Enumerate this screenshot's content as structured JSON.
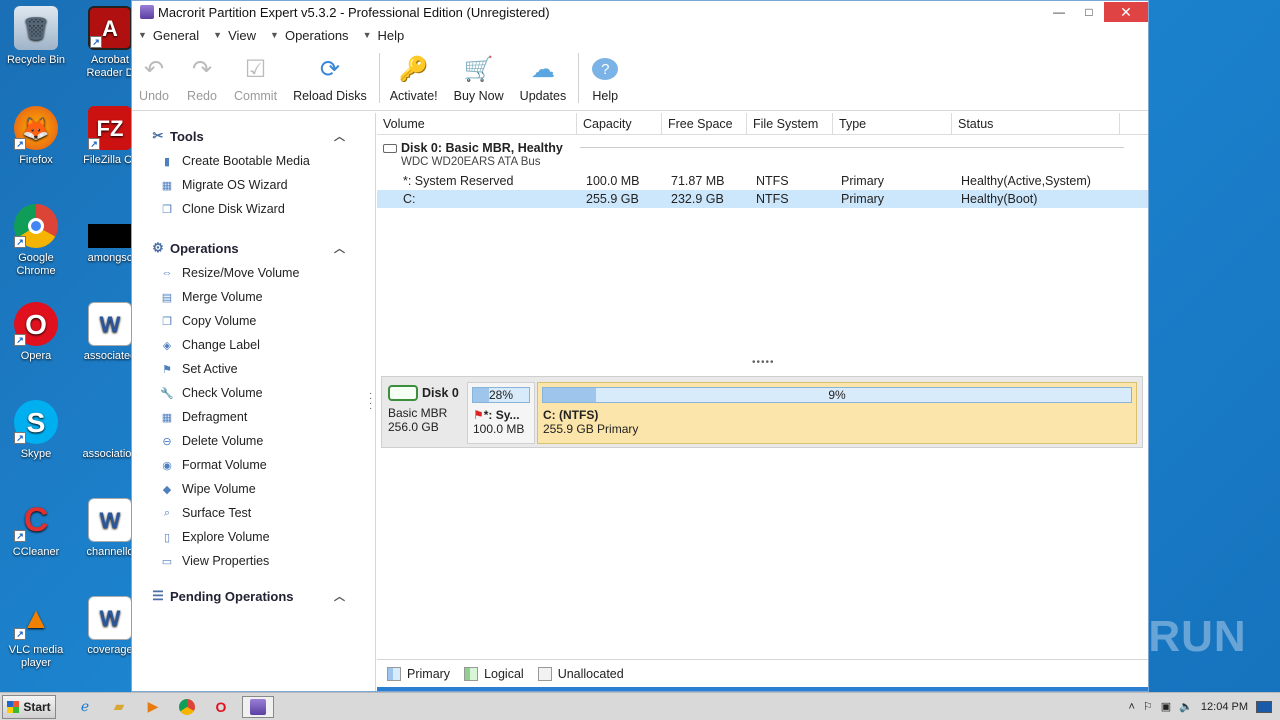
{
  "desktop": {
    "icons": [
      {
        "label": "Recycle Bin"
      },
      {
        "label": "Acrobat Reader D"
      },
      {
        "label": "Firefox"
      },
      {
        "label": "FileZilla Cli"
      },
      {
        "label": "Google Chrome"
      },
      {
        "label": "amongsc"
      },
      {
        "label": "Opera"
      },
      {
        "label": "associated"
      },
      {
        "label": "Skype"
      },
      {
        "label": "association"
      },
      {
        "label": "CCleaner"
      },
      {
        "label": "channello"
      },
      {
        "label": "VLC media player"
      },
      {
        "label": "coverage"
      }
    ],
    "watermark": "ANY RUN"
  },
  "window": {
    "title": "Macrorit Partition Expert v5.3.2 - Professional Edition (Unregistered)",
    "minimize": "—",
    "maximize": "□",
    "close": "✕"
  },
  "menu": [
    "General",
    "View",
    "Operations",
    "Help"
  ],
  "toolbar": {
    "undo": "Undo",
    "redo": "Redo",
    "commit": "Commit",
    "reload": "Reload Disks",
    "activate": "Activate!",
    "buy": "Buy Now",
    "updates": "Updates",
    "help": "Help"
  },
  "sidebar": {
    "tools_title": "Tools",
    "tools": [
      "Create Bootable Media",
      "Migrate OS Wizard",
      "Clone Disk Wizard"
    ],
    "operations_title": "Operations",
    "operations": [
      "Resize/Move Volume",
      "Merge Volume",
      "Copy Volume",
      "Change Label",
      "Set Active",
      "Check Volume",
      "Defragment",
      "Delete Volume",
      "Format Volume",
      "Wipe Volume",
      "Surface Test",
      "Explore Volume",
      "View Properties"
    ],
    "pending_title": "Pending Operations"
  },
  "table": {
    "columns": [
      "Volume",
      "Capacity",
      "Free Space",
      "File System",
      "Type",
      "Status"
    ],
    "disk_title": "Disk 0: Basic MBR, Healthy",
    "disk_model": "WDC WD20EARS ATA Bus",
    "rows": [
      {
        "volume": "*: System Reserved",
        "capacity": "100.0 MB",
        "free": "71.87 MB",
        "fs": "NTFS",
        "type": "Primary",
        "status": "Healthy(Active,System)"
      },
      {
        "volume": "C:",
        "capacity": "255.9 GB",
        "free": "232.9 GB",
        "fs": "NTFS",
        "type": "Primary",
        "status": "Healthy(Boot)"
      }
    ]
  },
  "diskmap": {
    "name": "Disk 0",
    "kind": "Basic MBR",
    "size": "256.0 GB",
    "parts": [
      {
        "pct_label": "28%",
        "used_fraction": 0.28,
        "name": "*: Sy...",
        "detail": "100.0 MB"
      },
      {
        "pct_label": "9%",
        "used_fraction": 0.09,
        "name": "C: (NTFS)",
        "detail": "255.9 GB Primary"
      }
    ]
  },
  "legend": [
    "Primary",
    "Logical",
    "Unallocated"
  ],
  "taskbar": {
    "start": "Start",
    "clock": "12:04 PM"
  }
}
